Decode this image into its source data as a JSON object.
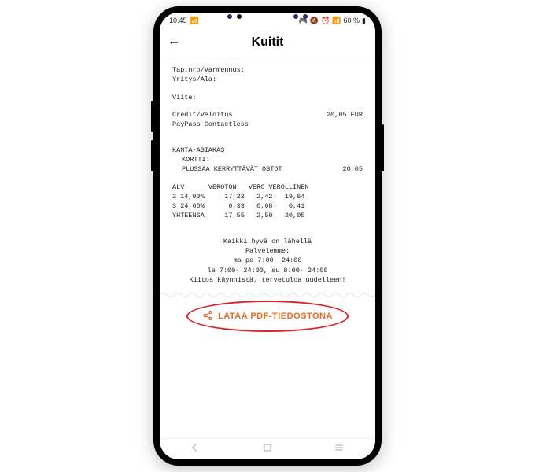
{
  "statusbar": {
    "time": "10.45",
    "battery": "60 %"
  },
  "appbar": {
    "title": "Kuitit"
  },
  "receipt": {
    "tap_label": "Tap.nro/Varmennus:",
    "company_label": "Yritys/Ala:",
    "ref_label": "Viite:",
    "charge_label": "Credit/Veloitus",
    "charge_value": "20,05 EUR",
    "paypass": "PayPass Contactless",
    "loyalty_header": "KANTA-ASIAKAS",
    "card_label": "KORTTI:",
    "plussa_label": "PLUSSAA KERRYTTÄVÄT OSTOT",
    "plussa_value": "20,05",
    "vat": {
      "h1": "ALV",
      "h2": "VEROTON",
      "h3": "VERO",
      "h4": "VEROLLINEN",
      "rows": [
        {
          "c1": "2",
          "c2": "14,00%",
          "c3": "17,22",
          "c4": "2,42",
          "c5": "19,64"
        },
        {
          "c1": "3",
          "c2": "24,00%",
          "c3": "0,33",
          "c4": "0,08",
          "c5": "0,41"
        }
      ],
      "total_label": "YHTEENSÄ",
      "total": {
        "c3": "17,55",
        "c4": "2,50",
        "c5": "20,05"
      }
    },
    "footer": {
      "l1": "Kaikki hyvä on lähellä",
      "l2": "Palvelemme:",
      "l3": "ma-pe 7:00- 24:00",
      "l4": "la 7:00- 24:00, su 8:00- 24:00",
      "l5": "Kiitos käynnistä, tervetuloa uudelleen!"
    }
  },
  "download": {
    "label": "LATAA PDF-TIEDOSTONA"
  }
}
